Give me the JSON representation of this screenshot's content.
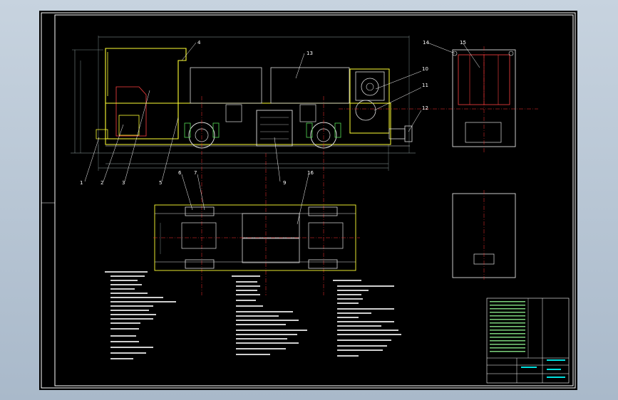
{
  "drawing": {
    "part_labels": [
      "1",
      "2",
      "3",
      "4",
      "5",
      "6",
      "7",
      "9",
      "10",
      "11",
      "12",
      "13",
      "14",
      "15",
      "16"
    ],
    "colors": {
      "background": "#000000",
      "frame": "#ffffff",
      "outline": "#ffff00",
      "equipment": "#d9d9d9",
      "centerline": "#ff3030",
      "text": "#ffffff",
      "title_block": "#00ffff"
    }
  }
}
